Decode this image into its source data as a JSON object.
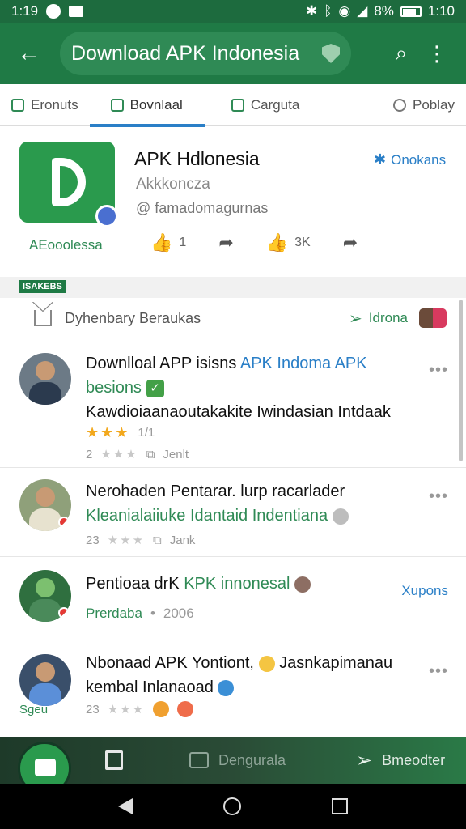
{
  "status_bar": {
    "time": "1:19",
    "battery": "8%",
    "clock_right": "1:10"
  },
  "app_bar": {
    "title": "Download APK Indonesia"
  },
  "tabs": [
    {
      "label": "Eronuts"
    },
    {
      "label": "Bovnlaal"
    },
    {
      "label": "Carguta"
    },
    {
      "label": "Poblay"
    }
  ],
  "app": {
    "name": "APK Hdlonesia",
    "subtitle": "Akkkoncza",
    "handle": "@ famadomagurnas",
    "follow_label": "Onokans",
    "developer": "AEooolessa",
    "action_like_count": "1",
    "action_share_count": "3K"
  },
  "section": {
    "tag": "ISAKEBS"
  },
  "filter": {
    "label": "Dyhenbary Beraukas",
    "right_label": "Idrona"
  },
  "items": [
    {
      "title_a": "Downlloal APP isisns ",
      "title_b": "APK Indoma APK",
      "title_c": "besions",
      "desc": "Kawdioiaanaoutakakite Iwindasian Intdaak",
      "rating_text": "1/1",
      "meta_num": "2",
      "meta_link": "Jenlt"
    },
    {
      "title_a": "Nerohaden Pentarar. ",
      "title_b": "lurp racarlader",
      "desc": "Kleanialaiiuke Idantaid Indentiana",
      "meta_num": "23",
      "meta_link": "Jank"
    },
    {
      "title_a": "Pentioaa drK ",
      "title_b": "KPK innonesal",
      "subtitle": "Prerdaba",
      "date": "2006",
      "side_link": "Xupons"
    },
    {
      "title": "Nbonaad APK Yontiont, ",
      "title_b": "Jasnkapimanau",
      "desc": "kembal Inlanaoad",
      "meta_num": "23",
      "caption": "Sgeu"
    }
  ],
  "bottom_nav": {
    "item2": "Dengurala",
    "item3": "Bmeodter"
  }
}
